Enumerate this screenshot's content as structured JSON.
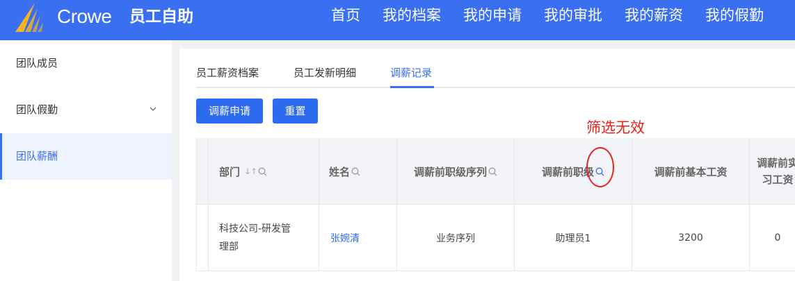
{
  "header": {
    "brand": "Crowe",
    "app_title": "员工自助",
    "nav": [
      "首页",
      "我的档案",
      "我的申请",
      "我的审批",
      "我的薪资",
      "我的假勤"
    ]
  },
  "sidebar": {
    "items": [
      {
        "label": "团队成员"
      },
      {
        "label": "团队假勤"
      },
      {
        "label": "团队薪酬"
      }
    ]
  },
  "tabs": [
    "员工薪资档案",
    "员工发新明细",
    "调薪记录"
  ],
  "buttons": {
    "apply": "调薪申请",
    "reset": "重置"
  },
  "annotation": "筛选无效",
  "table": {
    "columns": [
      "部门",
      "姓名",
      "调薪前职级序列",
      "调薪前职级",
      "调薪前基本工资",
      "调薪前实习工资"
    ],
    "rows": [
      {
        "dept_line1": "科技公司-研发管",
        "dept_line2": "理部",
        "name": "张婉清",
        "seq": "业务序列",
        "rank": "助理员1",
        "base": "3200",
        "intern": "0"
      }
    ]
  },
  "colors": {
    "primary": "#3a6ff2",
    "annotation": "#e8201c"
  }
}
